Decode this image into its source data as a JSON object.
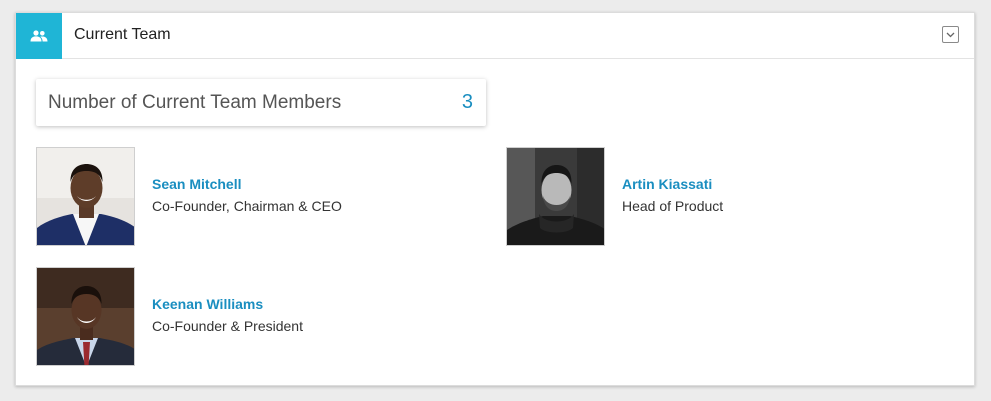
{
  "header": {
    "title": "Current Team",
    "icon": "people-icon",
    "collapse_icon": "chevron-down-icon"
  },
  "summary": {
    "label": "Number of Current Team Members",
    "count": "3"
  },
  "members": [
    {
      "name": "Sean Mitchell",
      "role": "Co-Founder, Chairman & CEO",
      "photo": "portrait-photo"
    },
    {
      "name": "Artin Kiassati",
      "role": "Head of Product",
      "photo": "portrait-photo-grayscale"
    },
    {
      "name": "Keenan Williams",
      "role": "Co-Founder & President",
      "photo": "portrait-photo"
    }
  ],
  "colors": {
    "accent": "#1fb5d6",
    "link": "#1a8ec0",
    "background": "#ececec"
  }
}
